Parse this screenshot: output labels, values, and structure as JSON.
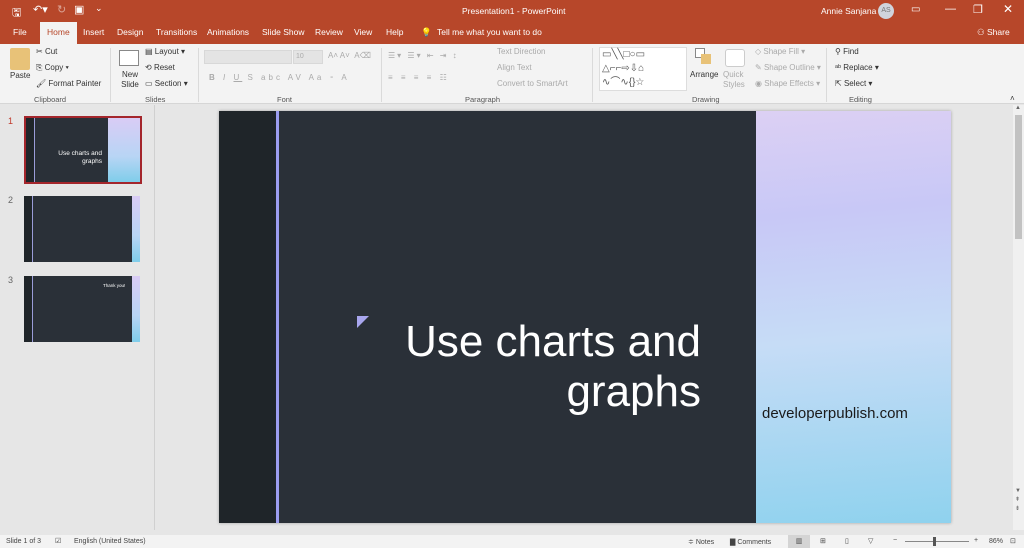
{
  "titlebar": {
    "doc_title": "Presentation1  -  PowerPoint",
    "user": "Annie Sanjana",
    "avatar": "AS",
    "share": "Share"
  },
  "tabs": [
    "File",
    "Home",
    "Insert",
    "Design",
    "Transitions",
    "Animations",
    "Slide Show",
    "Review",
    "View",
    "Help"
  ],
  "tell_me": "Tell me what you want to do",
  "ribbon": {
    "clipboard": {
      "paste": "Paste",
      "cut": "Cut",
      "copy": "Copy",
      "format_painter": "Format Painter",
      "label": "Clipboard"
    },
    "slides": {
      "new_slide": "New Slide",
      "layout": "Layout",
      "reset": "Reset",
      "section": "Section",
      "label": "Slides"
    },
    "font": {
      "size": "10",
      "label": "Font"
    },
    "paragraph": {
      "text_direction": "Text Direction",
      "align_text": "Align Text",
      "convert": "Convert to SmartArt",
      "label": "Paragraph"
    },
    "drawing": {
      "arrange": "Arrange",
      "quick_styles": "Quick Styles",
      "shape_fill": "Shape Fill",
      "shape_outline": "Shape Outline",
      "shape_effects": "Shape Effects",
      "label": "Drawing"
    },
    "editing": {
      "find": "Find",
      "replace": "Replace",
      "select": "Select",
      "label": "Editing"
    }
  },
  "thumbnails": [
    {
      "num": "1",
      "text": "Use charts and graphs",
      "selected": true
    },
    {
      "num": "2",
      "text": ""
    },
    {
      "num": "3",
      "text": "Thank you!"
    }
  ],
  "slide": {
    "title": "Use charts and graphs",
    "footer": "developerpublish.com"
  },
  "status": {
    "slide_info": "Slide 1 of 3",
    "language": "English (United States)",
    "notes": "Notes",
    "comments": "Comments",
    "zoom": "86%",
    "zoom_level": 0.86
  },
  "colors": {
    "accent": "#b7472a",
    "slide_bg": "#2a3038",
    "accent_line": "#9c9ef0"
  }
}
